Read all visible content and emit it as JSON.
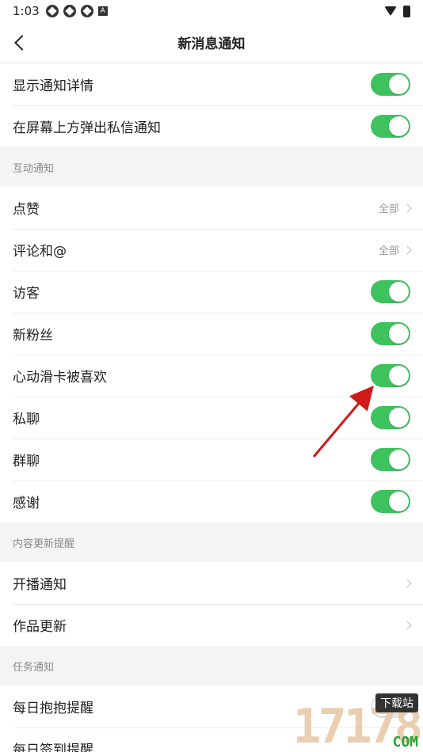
{
  "status_bar": {
    "time": "1:03",
    "badge": "A"
  },
  "header": {
    "title": "新消息通知"
  },
  "general": [
    {
      "label": "显示通知详情",
      "type": "toggle",
      "on": true
    },
    {
      "label": "在屏幕上方弹出私信通知",
      "type": "toggle",
      "on": true
    }
  ],
  "sections": {
    "interaction": {
      "title": "互动通知",
      "items": [
        {
          "label": "点赞",
          "value": "全部"
        },
        {
          "label": "评论和@",
          "value": "全部"
        },
        {
          "label": "访客"
        },
        {
          "label": "新粉丝"
        },
        {
          "label": "心动滑卡被喜欢"
        },
        {
          "label": "私聊"
        },
        {
          "label": "群聊"
        },
        {
          "label": "感谢"
        }
      ]
    },
    "content": {
      "title": "内容更新提醒",
      "items": [
        {
          "label": "开播通知"
        },
        {
          "label": "作品更新"
        }
      ]
    },
    "task": {
      "title": "任务通知",
      "items": [
        {
          "label": "每日抱抱提醒"
        },
        {
          "label": "每日签到提醒"
        }
      ]
    }
  },
  "watermark": {
    "digits": "17178",
    "badge": "下载站",
    "suffix": "COM"
  },
  "colors": {
    "toggle_on": "#3dc25d",
    "toggle_off": "#e5e5e5",
    "arrow": "#d01a1a"
  }
}
